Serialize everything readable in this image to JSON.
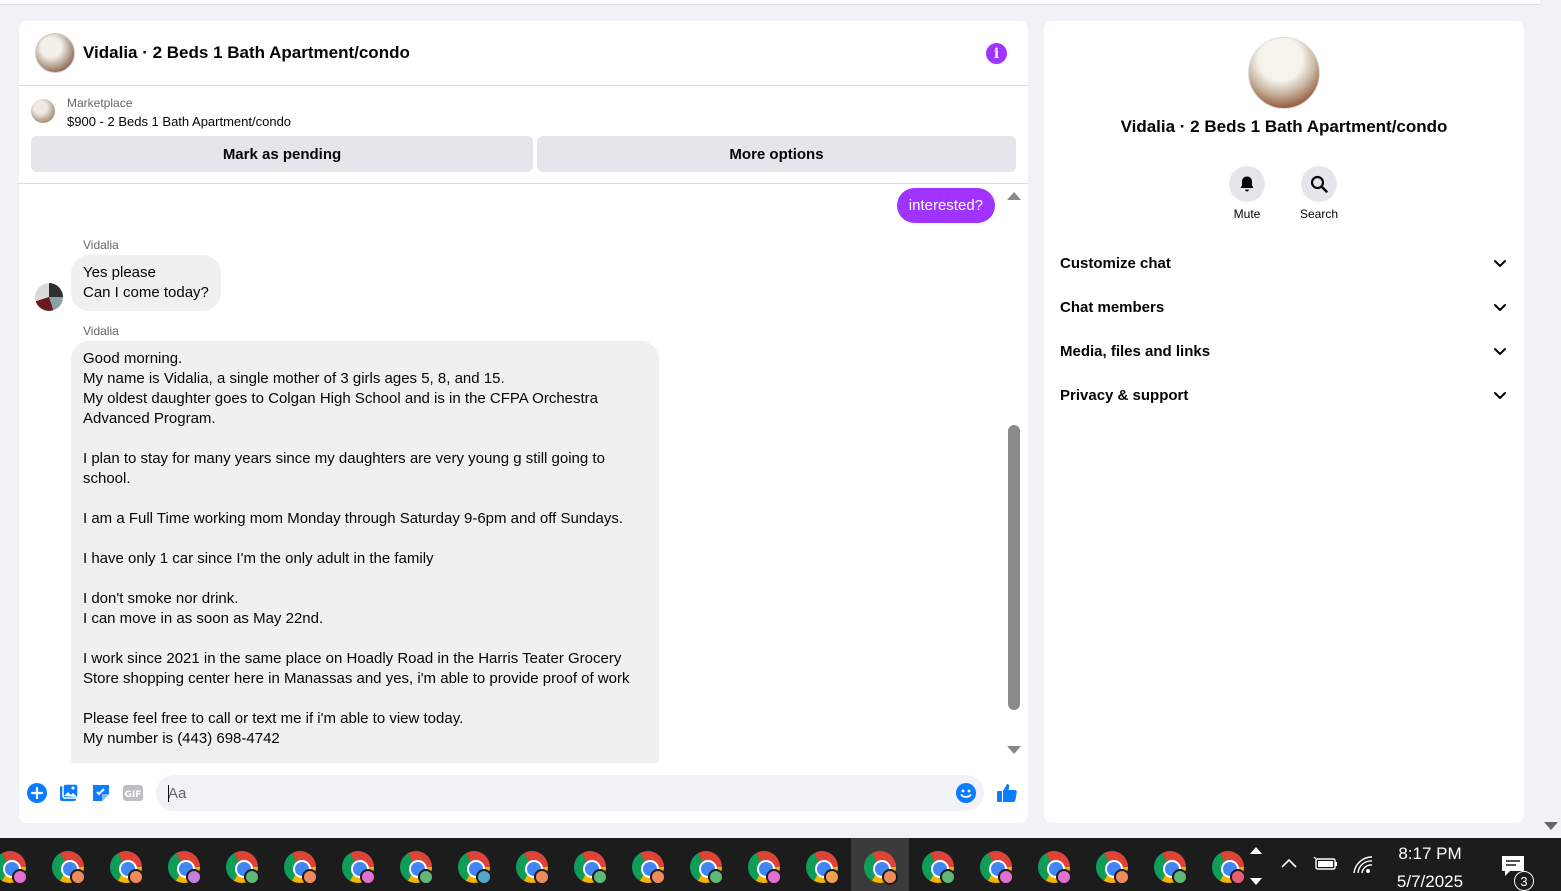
{
  "chat": {
    "title": "Vidalia · 2 Beds 1 Bath Apartment/condo",
    "marketplace": {
      "label": "Marketplace",
      "listing": "$900 - 2 Beds 1 Bath Apartment/condo",
      "mark_pending": "Mark as pending",
      "more_options": "More options"
    },
    "messages": [
      {
        "direction": "outgoing",
        "text": "interested?"
      },
      {
        "direction": "incoming",
        "sender": "Vidalia",
        "text": "Yes please\nCan I come today?"
      },
      {
        "direction": "incoming",
        "sender": "Vidalia",
        "text": "Good morning.\nMy name is Vidalia, a single mother of 3 girls ages 5, 8, and 15.\nMy oldest daughter goes to Colgan High School and is in the CFPA Orchestra\nAdvanced Program.\n\nI plan to stay for many years since my daughters are very young g still going to\nschool.\n\nI am a Full Time working mom Monday through Saturday 9-6pm and off Sundays.\n\nI have only 1 car since I'm the only adult in the family\n\nI don't smoke nor drink.\nI can move in as soon as May 22nd.\n\nI work since 2021 in the same place on Hoadly Road in the Harris Teater Grocery\nStore shopping center here in Manassas and yes, i'm able to provide proof of work\n\nPlease feel free to call or text me if i'm able to view today.\nMy number is (443) 698-4742"
      }
    ],
    "composer": {
      "placeholder": "Aa",
      "gif_label": "GIF"
    }
  },
  "info_panel": {
    "title": "Vidalia · 2 Beds 1 Bath Apartment/condo",
    "actions": [
      {
        "label": "Mute",
        "icon": "bell-icon"
      },
      {
        "label": "Search",
        "icon": "search-icon"
      }
    ],
    "sections": [
      "Customize chat",
      "Chat members",
      "Media, files and links",
      "Privacy & support"
    ]
  },
  "taskbar": {
    "time": "8:17 PM",
    "date": "5/7/2025",
    "notification_count": "3",
    "profile_colors": [
      "#e36fd0",
      "#f08a5d",
      "#f08a5d",
      "#c77ddb",
      "#5fb878",
      "#f08a5d",
      "#e36fd0",
      "#5fb878",
      "#4fa8c9",
      "#f08a5d",
      "#5fb878",
      "#f08a5d",
      "#5fb878",
      "#e36fd0",
      "#f0a050",
      "#f08a5d",
      "#5fb878",
      "#e36fd0",
      "#e36fd0",
      "#f08a5d",
      "#5fb878",
      "#e85d75"
    ]
  },
  "colors": {
    "accent": "#a033ff",
    "messenger_blue": "#0a7cff"
  }
}
